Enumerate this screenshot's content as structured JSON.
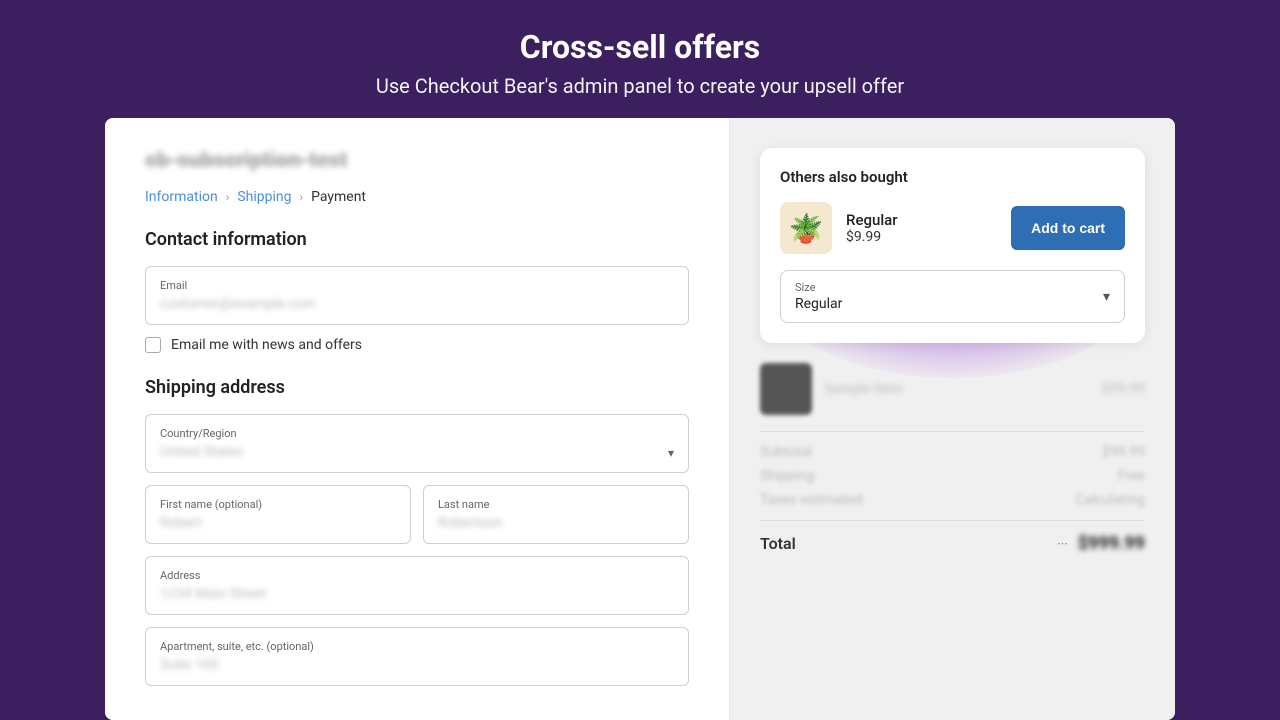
{
  "header": {
    "title": "Cross-sell offers",
    "subtitle": "Use Checkout Bear's admin panel to create your upsell offer"
  },
  "left": {
    "store_name": "cb-subscription-test",
    "breadcrumb": {
      "items": [
        "Information",
        "Shipping",
        "Payment"
      ]
    },
    "contact_section": {
      "title": "Contact information",
      "email_label": "Email",
      "email_value": "customer@example.com",
      "checkbox_label": "Email me with news and offers"
    },
    "shipping_section": {
      "title": "Shipping address",
      "country_label": "Country/Region",
      "country_value": "United States",
      "first_name_label": "First name (optional)",
      "first_name_value": "Robert",
      "last_name_label": "Last name",
      "last_name_value": "Robertson",
      "address_label": "Address",
      "address_value": "1234 Main Street",
      "apt_label": "Apartment, suite, etc. (optional)",
      "apt_value": "Suite 100"
    }
  },
  "right": {
    "crosssell": {
      "title": "Others also bought",
      "product_name": "Regular",
      "product_price": "$9.99",
      "add_to_cart_label": "Add to cart",
      "size_label": "Size",
      "size_value": "Regular"
    },
    "order": {
      "item_name": "Sample Item",
      "item_price": "$99.99",
      "subtotal_label": "Subtotal",
      "subtotal_value": "$99.99",
      "shipping_label": "Shipping",
      "shipping_value": "Free",
      "taxes_label": "Taxes estimated",
      "taxes_value": "Calculating",
      "total_label": "Total",
      "total_dots": "···",
      "total_value": "$999.99"
    }
  }
}
